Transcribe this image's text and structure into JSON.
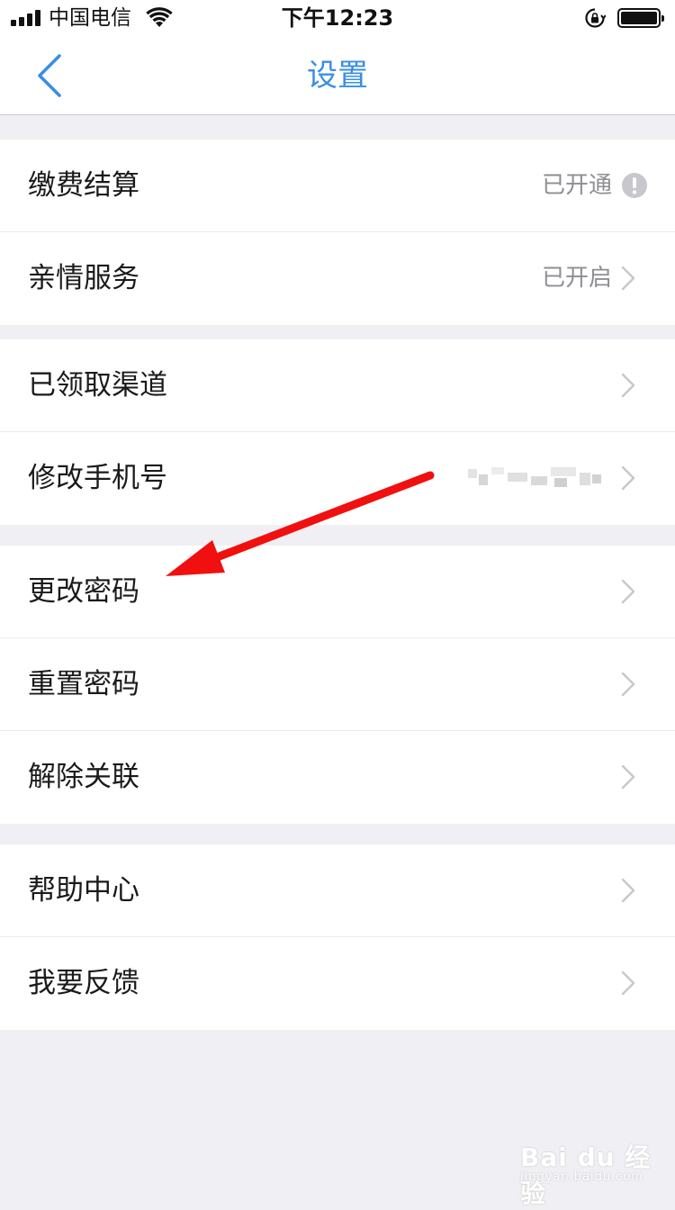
{
  "status_bar": {
    "carrier": "中国电信",
    "time": "下午12:23"
  },
  "nav": {
    "title": "设置",
    "back_icon": "chevron-left-icon"
  },
  "groups": [
    {
      "items": [
        {
          "label": "缴费结算",
          "value": "已开通",
          "trailing_icon": "alert-icon"
        },
        {
          "label": "亲情服务",
          "value": "已开启",
          "trailing_icon": "chevron-right-icon"
        }
      ]
    },
    {
      "items": [
        {
          "label": "已领取渠道",
          "value": "",
          "trailing_icon": "chevron-right-icon"
        },
        {
          "label": "修改手机号",
          "value": "",
          "trailing_icon": "chevron-right-icon"
        }
      ]
    },
    {
      "items": [
        {
          "label": "更改密码",
          "value": "",
          "trailing_icon": "chevron-right-icon"
        },
        {
          "label": "重置密码",
          "value": "",
          "trailing_icon": "chevron-right-icon"
        },
        {
          "label": "解除关联",
          "value": "",
          "trailing_icon": "chevron-right-icon"
        }
      ]
    },
    {
      "items": [
        {
          "label": "帮助中心",
          "value": "",
          "trailing_icon": "chevron-right-icon"
        },
        {
          "label": "我要反馈",
          "value": "",
          "trailing_icon": "chevron-right-icon"
        }
      ]
    }
  ],
  "colors": {
    "accent": "#3a8ee6",
    "background": "#efeff4",
    "annotation_arrow": "#f01010"
  },
  "watermark": {
    "logo": "Bai du 经验",
    "url": "jingyan.baidu.com"
  }
}
